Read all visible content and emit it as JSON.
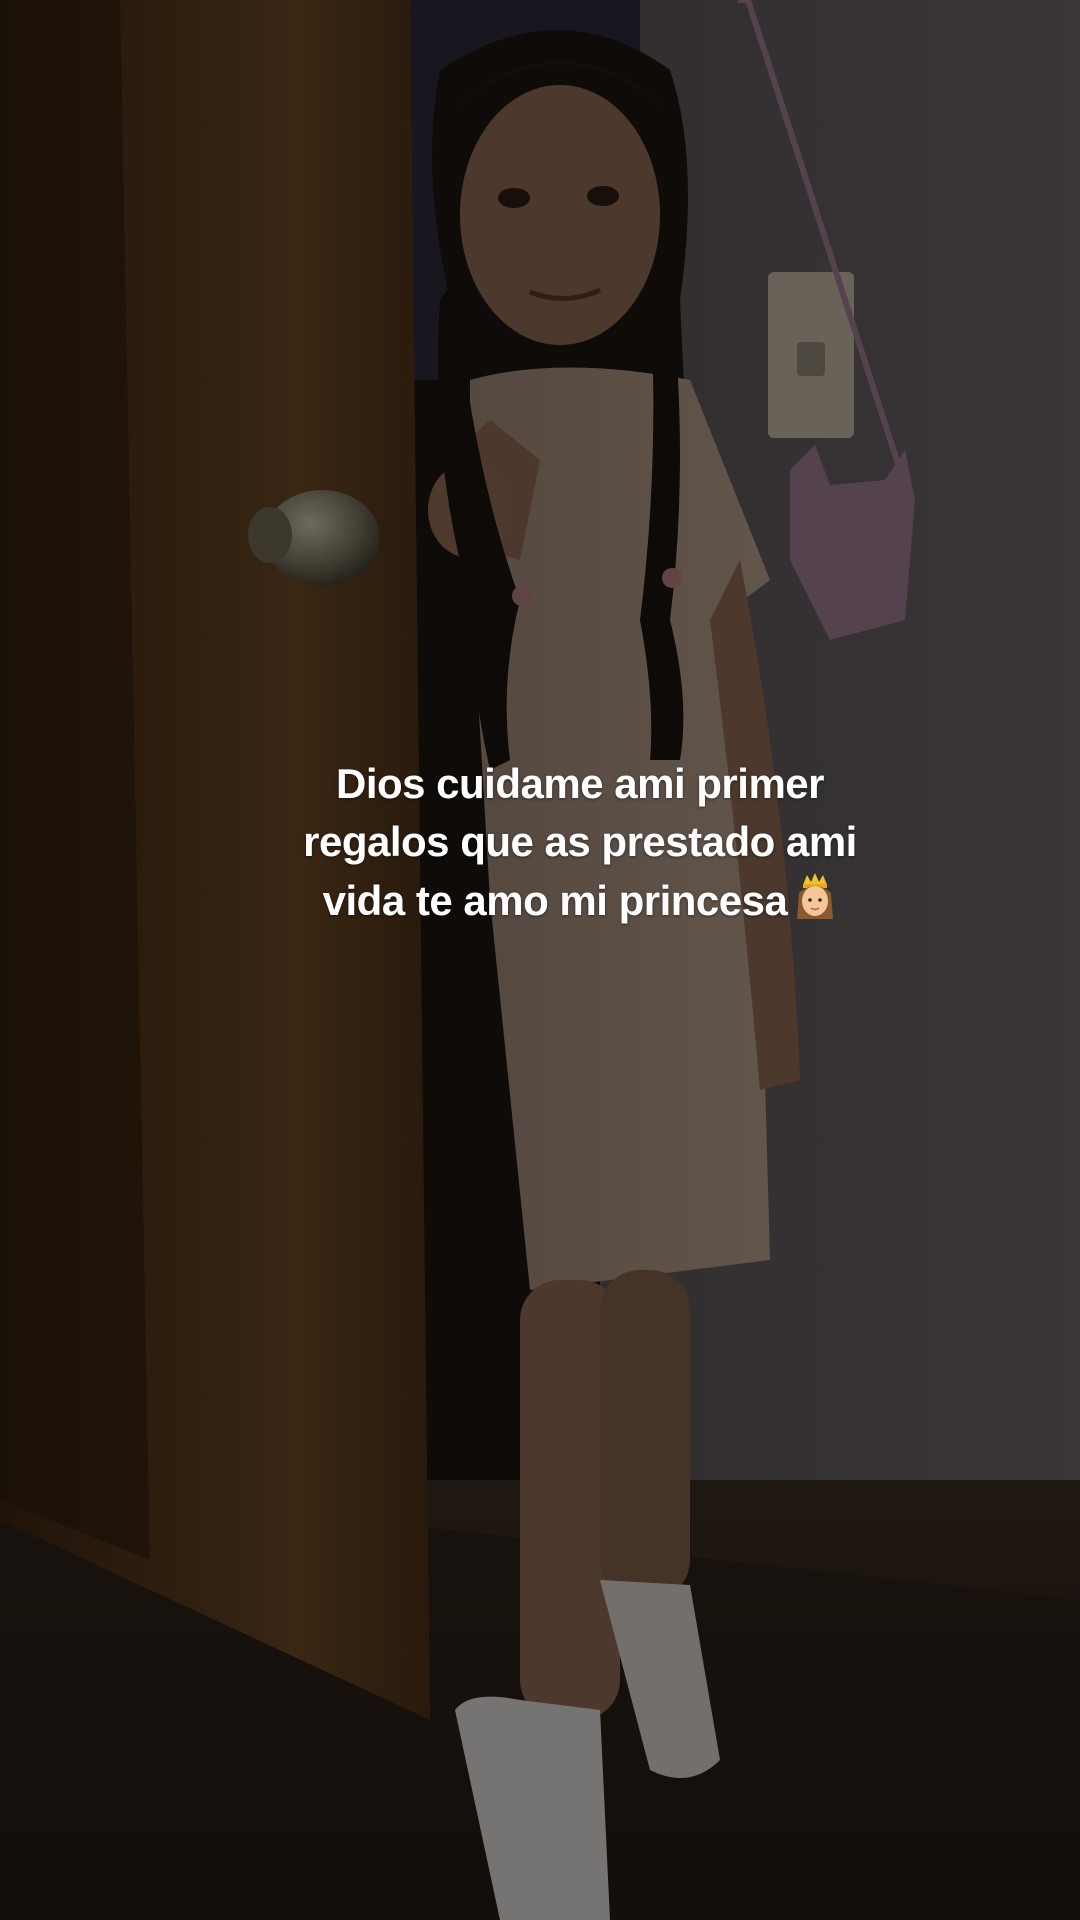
{
  "caption": {
    "lines": [
      "Dios cuidame ami primer",
      "regalos que as prestado ami",
      "vida te amo mi princesa"
    ],
    "emoji": "princess-emoji-icon"
  },
  "colors": {
    "door": "#5a3a1c",
    "wall": "#4a4446",
    "floor": "#2a201a",
    "dress": "#8a7566",
    "hair": "#1c1512",
    "socks": "#d8d4d0",
    "caption_text": "#ffffff"
  }
}
